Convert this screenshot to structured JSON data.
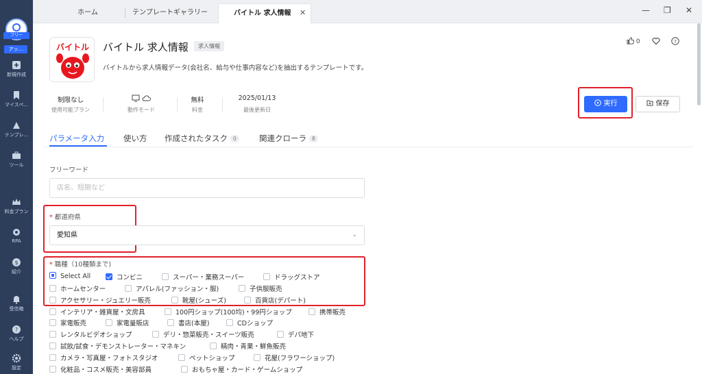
{
  "sidebar": {
    "user_tag": "フリー",
    "app_tag": "アッ...",
    "items": [
      {
        "label": "新規作成",
        "icon": "plus-square-icon"
      },
      {
        "label": "マイスペ...",
        "icon": "bookmark-icon"
      },
      {
        "label": "テンプレ...",
        "icon": "template-icon"
      },
      {
        "label": "ツール",
        "icon": "toolbox-icon"
      },
      {
        "label": "料金プラン",
        "icon": "crown-icon"
      },
      {
        "label": "RPA",
        "icon": "rpa-icon"
      },
      {
        "label": "紹介",
        "icon": "dollar-icon"
      },
      {
        "label": "受信箱",
        "icon": "bell-icon"
      },
      {
        "label": "ヘルプ",
        "icon": "help-icon"
      },
      {
        "label": "設定",
        "icon": "gear-icon"
      }
    ]
  },
  "tabs": [
    {
      "label": "ホーム"
    },
    {
      "label": "テンプレートギャラリー"
    },
    {
      "label": "バイトル 求人情報",
      "active": true
    }
  ],
  "header": {
    "logo_text": "バイトル",
    "title": "バイトル 求人情報",
    "badge": "求人情報",
    "description": "バイトルから求人情報データ(会社名、給与や仕事内容など)を抽出するテンプレートです。",
    "like_count": "0"
  },
  "meta": [
    {
      "value": "制限なし",
      "label": "使用可能プラン"
    },
    {
      "value": "",
      "label": "動作モード"
    },
    {
      "value": "無料",
      "label": "料金"
    },
    {
      "value": "2025/01/13",
      "label": "最後更新日"
    }
  ],
  "actions": {
    "run": "実行",
    "save": "保存"
  },
  "subtabs": [
    {
      "label": "パラメータ入力",
      "count": null
    },
    {
      "label": "使い方",
      "count": null
    },
    {
      "label": "作成されたタスク",
      "count": "0"
    },
    {
      "label": "関連クローラ",
      "count": "8"
    }
  ],
  "form": {
    "keyword": {
      "label": "フリーワード",
      "placeholder": "店名、短期など"
    },
    "prefecture": {
      "label": "都道府県",
      "value": "愛知県"
    },
    "job": {
      "label": "職種（10種類まで)",
      "options": [
        {
          "label": "Select All",
          "state": "partial"
        },
        {
          "label": "コンビニ",
          "state": "checked"
        },
        {
          "label": "スーパー・業務スーパー",
          "state": "none"
        },
        {
          "label": "ドラッグストア",
          "state": "none"
        },
        {
          "label": "ホームセンター",
          "state": "none"
        },
        {
          "label": "アパレル(ファッション・服)",
          "state": "none"
        },
        {
          "label": "子供服販売",
          "state": "none"
        },
        {
          "label": "アクセサリー・ジュエリー販売",
          "state": "none"
        },
        {
          "label": "靴屋(シューズ)",
          "state": "none"
        },
        {
          "label": "百貨店(デパート)",
          "state": "none"
        },
        {
          "label": "インテリア・雑貨屋・文房具",
          "state": "none"
        },
        {
          "label": "100円ショップ(100均)・99円ショップ",
          "state": "none"
        },
        {
          "label": "携帯販売",
          "state": "none"
        },
        {
          "label": "家電販売",
          "state": "none"
        },
        {
          "label": "家電量販店",
          "state": "none"
        },
        {
          "label": "書店(本屋)",
          "state": "none"
        },
        {
          "label": "CDショップ",
          "state": "none"
        },
        {
          "label": "レンタルビデオショップ",
          "state": "none"
        },
        {
          "label": "デリ・惣菜販売・スイーツ販売",
          "state": "none"
        },
        {
          "label": "デパ地下",
          "state": "none"
        },
        {
          "label": "試飲/試食・デモンストレーター・マネキン",
          "state": "none"
        },
        {
          "label": "精肉・青果・鮮魚販売",
          "state": "none"
        },
        {
          "label": "カメラ・写真屋・フォトスタジオ",
          "state": "none"
        },
        {
          "label": "ペットショップ",
          "state": "none"
        },
        {
          "label": "花屋(フラワーショップ)",
          "state": "none"
        },
        {
          "label": "化粧品・コスメ販売・美容部員",
          "state": "none"
        },
        {
          "label": "おもちゃ屋・カード・ゲームショップ",
          "state": "none"
        }
      ]
    }
  },
  "colors": {
    "accent": "#2f6bff",
    "highlight": "#e0202a",
    "sidebar": "#2d3e5b"
  }
}
